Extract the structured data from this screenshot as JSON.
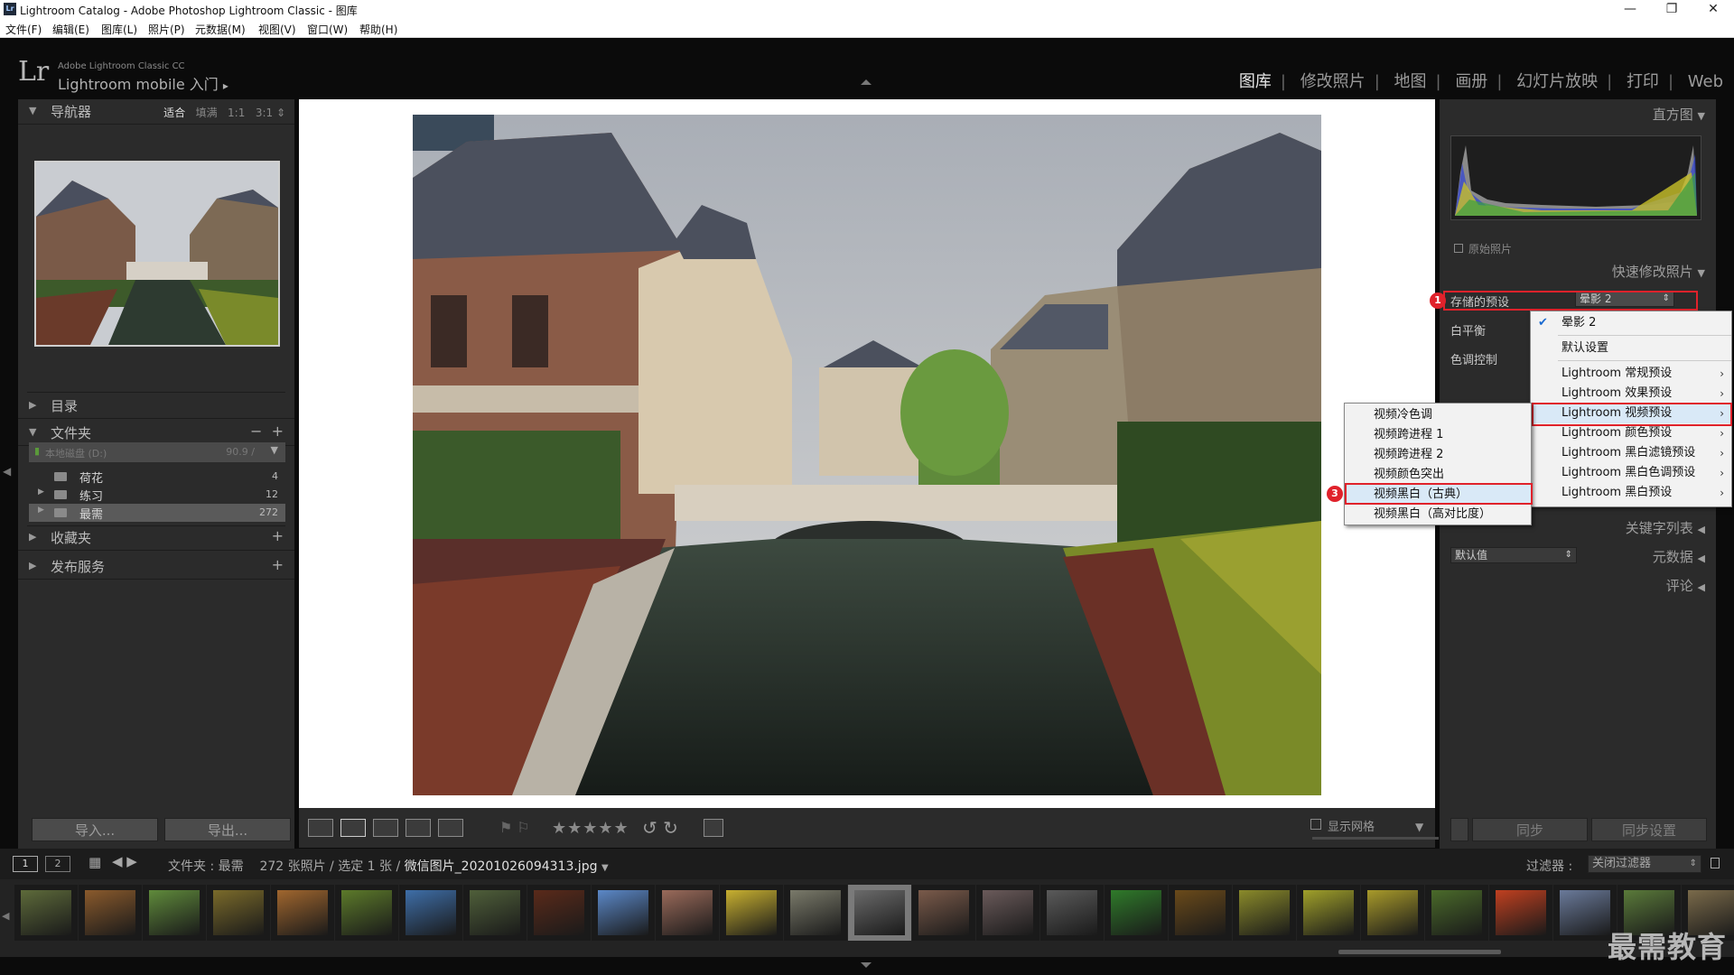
{
  "window": {
    "title": "Lightroom Catalog - Adobe Photoshop Lightroom Classic - 图库",
    "app_icon_text": "Lr",
    "controls": [
      "—",
      "❐",
      "✕"
    ]
  },
  "menubar": [
    "文件(F)",
    "编辑(E)",
    "图库(L)",
    "照片(P)",
    "元数据(M)",
    "视图(V)",
    "窗口(W)",
    "帮助(H)"
  ],
  "identity": {
    "logo": "Lr",
    "product": "Adobe Lightroom Classic CC",
    "mobile": "Lightroom mobile 入门",
    "mobile_arrow": "▸"
  },
  "modules": [
    "图库",
    "修改照片",
    "地图",
    "画册",
    "幻灯片放映",
    "打印",
    "Web"
  ],
  "active_module": "图库",
  "left_panel": {
    "navigator": {
      "title": "导航器",
      "options": [
        "适合",
        "填满",
        "1:1",
        "3:1"
      ],
      "active_option": "适合"
    },
    "catalog": {
      "title": "目录"
    },
    "folders": {
      "title": "文件夹",
      "volume_label": "本地磁盘 (D:)",
      "volume_info": "90.9 /",
      "items": [
        {
          "name": "荷花",
          "count": "4"
        },
        {
          "name": "练习",
          "count": "12"
        },
        {
          "name": "最需",
          "count": "272"
        }
      ]
    },
    "collections": {
      "title": "收藏夹"
    },
    "publish": {
      "title": "发布服务"
    },
    "import_button": "导入...",
    "export_button": "导出..."
  },
  "right_panel": {
    "histogram": {
      "title": "直方图",
      "original_photo": "原始照片"
    },
    "quick_develop": {
      "title": "快速修改照片"
    },
    "saved_preset_label": "存储的预设",
    "saved_preset_value": "晕影 2",
    "white_balance_label": "白平衡",
    "tone_control_label": "色调控制",
    "keyword_list": "关键字列表",
    "metadata": "元数据",
    "metadata_default": "默认值",
    "comments": "评论",
    "sync_button": "同步",
    "sync_settings_button": "同步设置"
  },
  "preset_menu": {
    "items": [
      {
        "label": "晕影 2",
        "checked": true,
        "sub": false
      },
      {
        "label": "默认设置",
        "checked": false,
        "sub": false
      },
      {
        "label": "Lightroom 常规预设",
        "checked": false,
        "sub": true
      },
      {
        "label": "Lightroom 效果预设",
        "checked": false,
        "sub": true
      },
      {
        "label": "Lightroom 视频预设",
        "checked": false,
        "sub": true
      },
      {
        "label": "Lightroom 颜色预设",
        "checked": false,
        "sub": true
      },
      {
        "label": "Lightroom 黑白滤镜预设",
        "checked": false,
        "sub": true
      },
      {
        "label": "Lightroom 黑白色调预设",
        "checked": false,
        "sub": true
      },
      {
        "label": "Lightroom 黑白预设",
        "checked": false,
        "sub": true
      }
    ],
    "highlighted": "Lightroom 视频预设"
  },
  "video_submenu": {
    "items": [
      "视频冷色调",
      "视频跨进程 1",
      "视频跨进程 2",
      "视频颜色突出",
      "视频黑白（古典）",
      "视频黑白（高对比度）"
    ],
    "highlighted": "视频黑白（古典）"
  },
  "badges": [
    "1",
    "2",
    "3"
  ],
  "toolbar": {
    "stars": "★★★★★",
    "show_grid": "显示网格"
  },
  "filmstrip": {
    "view1": "1",
    "view2": "2",
    "source": "文件夹 : 最需",
    "count_text": "272 张照片 / 选定 1 张 /",
    "filename": "微信图片_20201026094313.jpg",
    "filter_label": "过滤器 :",
    "filter_value": "关闭过滤器",
    "thumbs": [
      "#5d6a3a",
      "#8a5a2c",
      "#5f8a3b",
      "#7a6a2a",
      "#a0662e",
      "#5c7a2a",
      "#3e6ea8",
      "#4f5f3a",
      "#5a2a1a",
      "#5b88c8",
      "#9a6a5a",
      "#c8b030",
      "#7a7a6a",
      "#6a6a6a",
      "#7a5a4a",
      "#6a5a5a",
      "#5a5a5a",
      "#2f7a2a",
      "#6a4a1a",
      "#8a8a2a",
      "#a0a02a",
      "#a89a2a",
      "#4a6a2a",
      "#c04020",
      "#6a7a9a",
      "#5a7a3a",
      "#7a6a4a"
    ],
    "selected_index": 13
  },
  "watermark": "最需教育",
  "colors": {
    "accent_red": "#e0222b",
    "menu_highlight": "#d9e9f7",
    "panel_bg": "#2b2b2b"
  }
}
